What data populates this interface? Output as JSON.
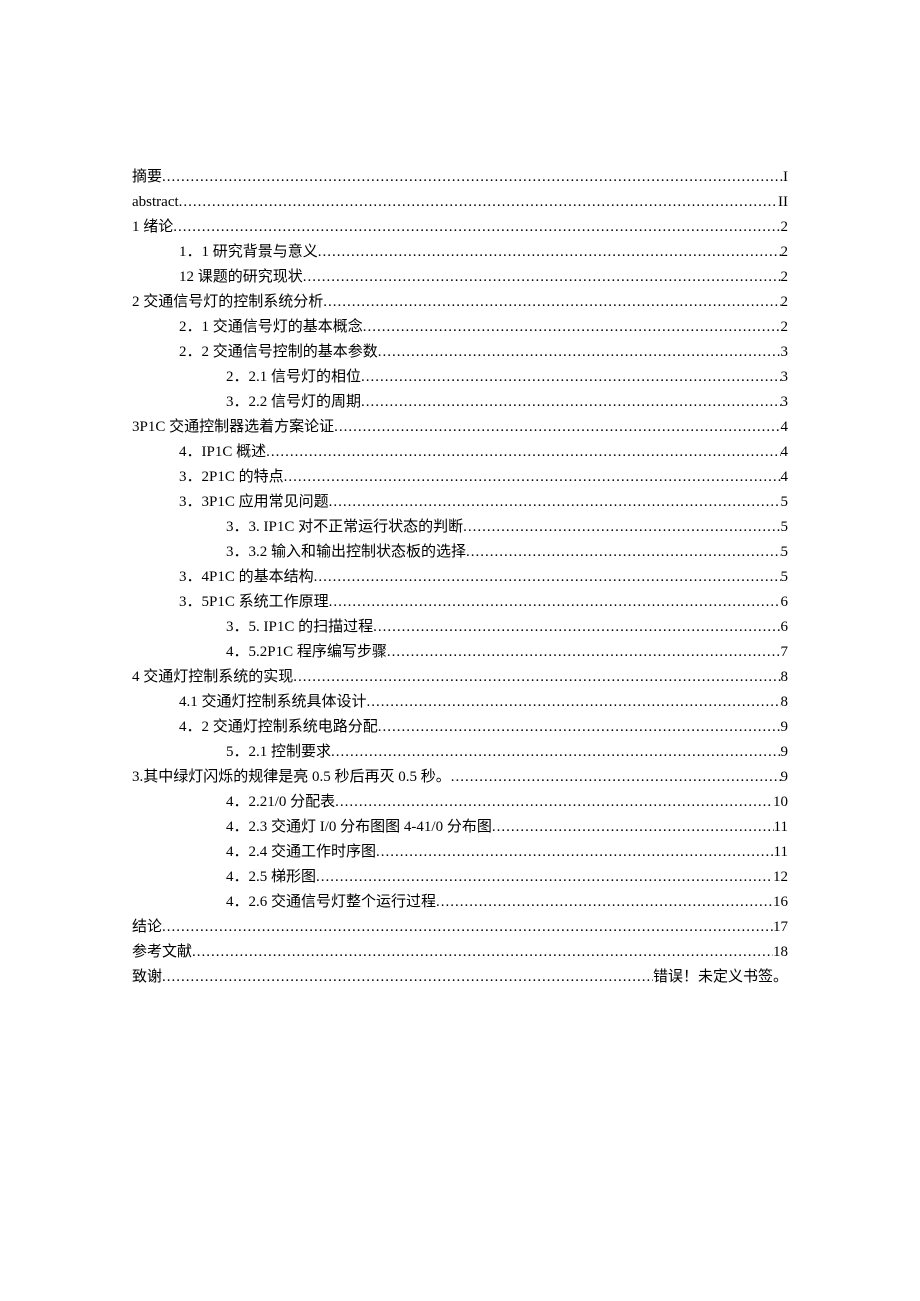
{
  "toc": [
    {
      "label": "摘要",
      "page": "I",
      "indent": 0
    },
    {
      "label": "abstract ",
      "page": "II",
      "indent": 0
    },
    {
      "label": "1 绪论",
      "page": "2",
      "indent": 0
    },
    {
      "label": "1．1 研究背景与意义 ",
      "page": "2",
      "indent": 1
    },
    {
      "label": "12 课题的研究现状 ",
      "page": "2",
      "indent": 1
    },
    {
      "label": "2 交通信号灯的控制系统分析",
      "page": "2",
      "indent": 0
    },
    {
      "label": "2．1 交通信号灯的基本概念 ",
      "page": "2",
      "indent": 1
    },
    {
      "label": "2．2 交通信号控制的基本参数 ",
      "page": "3",
      "indent": 1
    },
    {
      "label": "2．2.1 信号灯的相位 ",
      "page": "3",
      "indent": 2
    },
    {
      "label": "3．2.2 信号灯的周期",
      "page": "3",
      "indent": 2
    },
    {
      "label": "3P1C 交通控制器选着方案论证",
      "page": "4",
      "indent": 0
    },
    {
      "label": "4．IP1C 概述",
      "page": "4",
      "indent": 1
    },
    {
      "label": "3．2P1C 的特点",
      "page": "4",
      "indent": 1
    },
    {
      "label": "3．3P1C 应用常见问题",
      "page": "5",
      "indent": 1
    },
    {
      "label": "3．3. IP1C 对不正常运行状态的判断",
      "page": "5",
      "indent": 2
    },
    {
      "label": "3．3.2 输入和输出控制状态板的选择 ",
      "page": "5",
      "indent": 2
    },
    {
      "label": "3．4P1C 的基本结构 ",
      "page": "5",
      "indent": 1
    },
    {
      "label": "3．5P1C 系统工作原理",
      "page": "6",
      "indent": 1
    },
    {
      "label": "3．5. IP1C 的扫描过程",
      "page": "6",
      "indent": 2
    },
    {
      "label": "4．5.2P1C 程序编写步骤",
      "page": "7",
      "indent": 2
    },
    {
      "label": "4 交通灯控制系统的实现 ",
      "page": "8",
      "indent": 0
    },
    {
      "label": "4.1 交通灯控制系统具体设计 ",
      "page": "8",
      "indent": 1
    },
    {
      "label": "4．2 交通灯控制系统电路分配 ",
      "page": "9",
      "indent": 1
    },
    {
      "label": "5．2.1 控制要求",
      "page": "9",
      "indent": 2
    },
    {
      "label": "3.其中绿灯闪烁的规律是亮 0.5 秒后再灭 0.5 秒。",
      "page": "9",
      "indent": 0
    },
    {
      "label": "4．2.21/0 分配表",
      "page": "10",
      "indent": 2
    },
    {
      "label": "4．2.3 交通灯 I/0 分布图图 4-41/0 分布图 ",
      "page": "11",
      "indent": 2
    },
    {
      "label": "4．2.4 交通工作时序图",
      "page": "11",
      "indent": 2
    },
    {
      "label": "4．2.5 梯形图 ",
      "page": "12",
      "indent": 2
    },
    {
      "label": "4．2.6 交通信号灯整个运行过程",
      "page": "16",
      "indent": 2
    },
    {
      "label": "结论 ",
      "page": "17",
      "indent": 0
    },
    {
      "label": "参考文献 ",
      "page": "18",
      "indent": 0
    },
    {
      "label": "致谢 ",
      "page": "错误！未定义书签。",
      "indent": 0
    }
  ]
}
